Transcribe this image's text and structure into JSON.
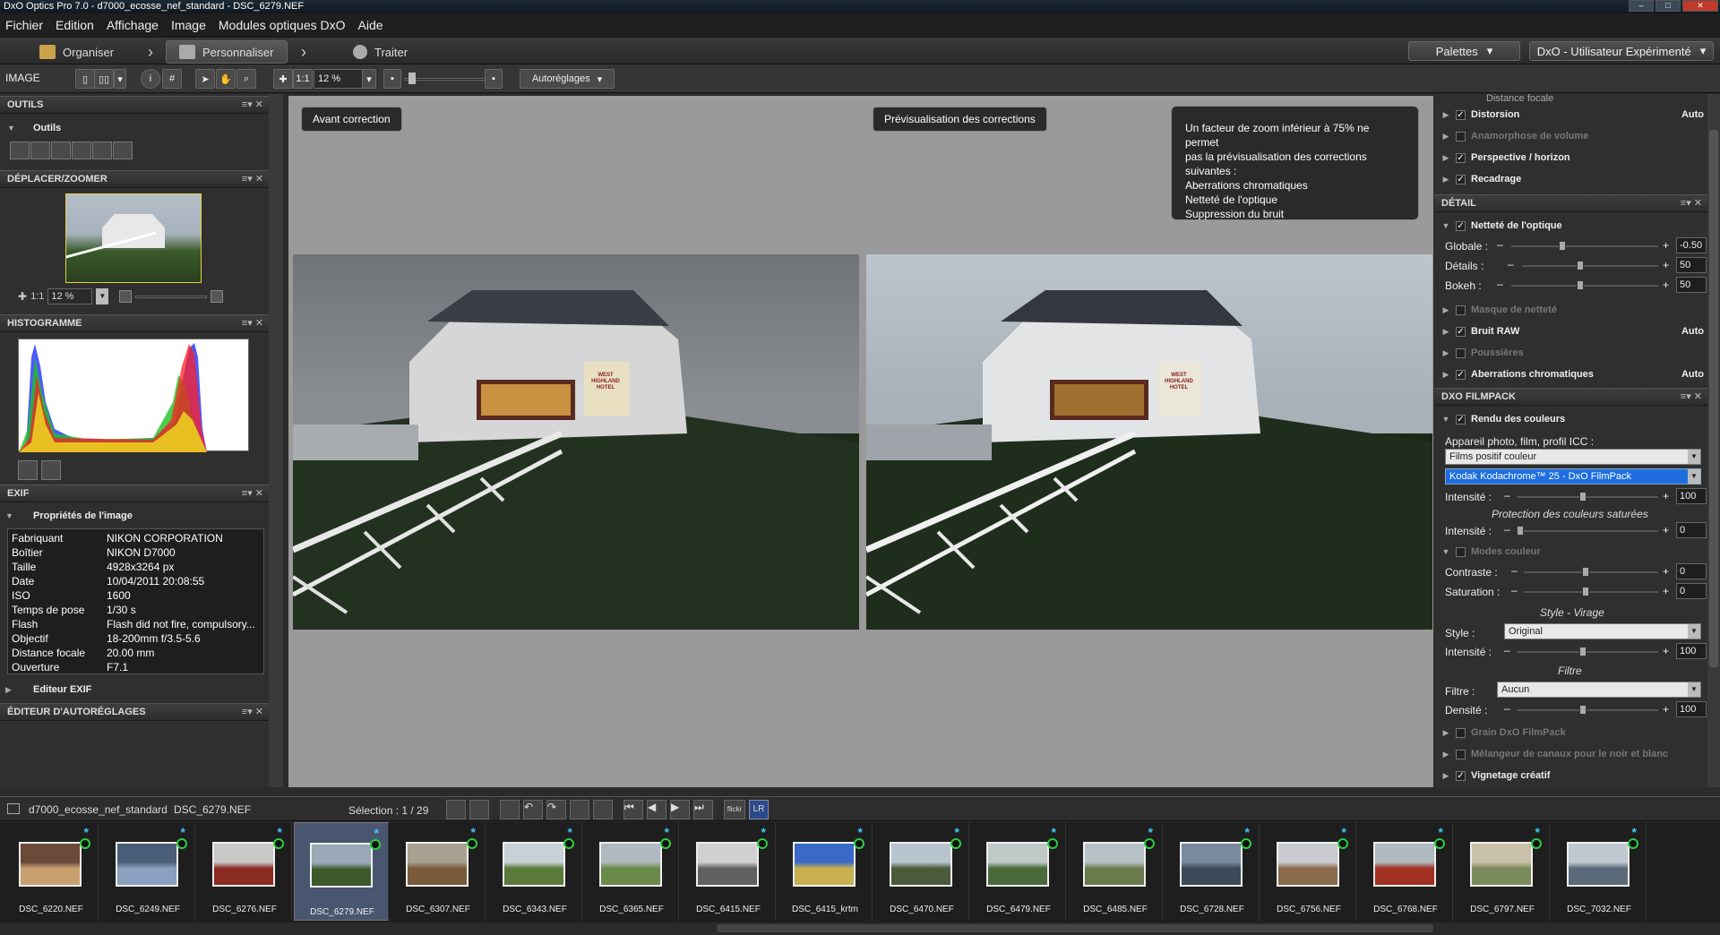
{
  "window": {
    "title": "DxO Optics Pro 7.0 - d7000_ecosse_nef_standard - DSC_6279.NEF"
  },
  "menu": [
    "Fichier",
    "Edition",
    "Affichage",
    "Image",
    "Modules optiques DxO",
    "Aide"
  ],
  "modules": {
    "organise": "Organiser",
    "customize": "Personnaliser",
    "process": "Traiter"
  },
  "topright": {
    "palettes": "Palettes",
    "workspace": "DxO - Utilisateur Expérimenté"
  },
  "toolbar": {
    "label": "IMAGE",
    "one_to_one": "1:1",
    "zoom": "12 %",
    "autopreset": "Autoréglages"
  },
  "left": {
    "tools_header": "OUTILS",
    "tools_sub": "Outils",
    "move_header": "DÉPLACER/ZOOMER",
    "move_zoom": "12 %",
    "move_one": "1:1",
    "histo_header": "HISTOGRAMME",
    "exif_header": "EXIF",
    "exif_sub": "Propriétés de l'image",
    "exif_rows": [
      {
        "k": "Fabriquant",
        "v": "NIKON CORPORATION"
      },
      {
        "k": "Boîtier",
        "v": "NIKON D7000"
      },
      {
        "k": "Taille",
        "v": "4928x3264 px"
      },
      {
        "k": "Date",
        "v": "10/04/2011 20:08:55"
      },
      {
        "k": "ISO",
        "v": "1600"
      },
      {
        "k": "Temps de pose",
        "v": "1/30 s"
      },
      {
        "k": "Flash",
        "v": "Flash did not fire, compulsory..."
      },
      {
        "k": "Objectif",
        "v": "18-200mm f/3.5-5.6"
      },
      {
        "k": "Distance focale",
        "v": "20.00 mm"
      },
      {
        "k": "Ouverture",
        "v": "F7.1"
      }
    ],
    "exif_editor": "Editeur EXIF",
    "preset_header": "ÉDITEUR D'AUTORÉGLAGES"
  },
  "center": {
    "before": "Avant correction",
    "preview": "Prévisualisation des corrections",
    "info_lines": [
      "Un facteur de zoom inférieur à 75% ne permet",
      "pas la prévisualisation des corrections",
      "suivantes :",
      "Aberrations chromatiques",
      "Netteté de l'optique",
      "Suppression du bruit"
    ],
    "sign_lines": [
      "WEST",
      "HIGHLAND",
      "HOTEL"
    ]
  },
  "right": {
    "partial": "Distance focale",
    "geo_items": [
      {
        "label": "Distorsion",
        "checked": true,
        "auto": "Auto"
      },
      {
        "label": "Anamorphose de volume",
        "checked": false,
        "auto": ""
      },
      {
        "label": "Perspective / horizon",
        "checked": true,
        "auto": ""
      },
      {
        "label": "Recadrage",
        "checked": true,
        "auto": ""
      }
    ],
    "detail_header": "DÉTAIL",
    "sharp_label": "Netteté de l'optique",
    "sliders_detail": [
      {
        "label": "Globale :",
        "value": "-0.50",
        "pos": 0.4
      },
      {
        "label": "Détails :",
        "value": "50",
        "pos": 0.5
      },
      {
        "label": "Bokeh :",
        "value": "50",
        "pos": 0.5
      }
    ],
    "detail_items": [
      {
        "label": "Masque de netteté",
        "checked": false,
        "auto": ""
      },
      {
        "label": "Bruit RAW",
        "checked": true,
        "auto": "Auto"
      },
      {
        "label": "Poussières",
        "checked": false,
        "auto": ""
      },
      {
        "label": "Aberrations chromatiques",
        "checked": true,
        "auto": "Auto"
      }
    ],
    "filmpack_header": "DXO FILMPACK",
    "color_render": "Rendu des couleurs",
    "profile_label": "Appareil photo, film, profil ICC :",
    "profile_cat": "Films positif couleur",
    "profile_film": "Kodak Kodachrome™ 25 - DxO FilmPack",
    "intensity": "Intensité :",
    "intensity_val": "100",
    "protect_label": "Protection des couleurs saturées",
    "protect_val": "0",
    "color_modes": "Modes couleur",
    "contrast": "Contraste :",
    "contrast_val": "0",
    "saturation": "Saturation :",
    "saturation_val": "0",
    "style_title": "Style - Virage",
    "style_label": "Style :",
    "style_val": "Original",
    "style_int_val": "100",
    "filter_title": "Filtre",
    "filter_label": "Filtre :",
    "filter_val": "Aucun",
    "density": "Densité :",
    "density_val": "100",
    "bottom_items": [
      {
        "label": "Grain DxO FilmPack",
        "checked": false
      },
      {
        "label": "Mélangeur de canaux pour le noir et blanc",
        "checked": false
      },
      {
        "label": "Vignetage créatif",
        "checked": true
      }
    ]
  },
  "filmbar": {
    "folder": "d7000_ecosse_nef_standard",
    "file": "DSC_6279.NEF",
    "selection": "Sélection : 1 / 29",
    "flickr": "flickr",
    "lr": "LR"
  },
  "thumbs": [
    {
      "name": "DSC_6220.NEF",
      "c1": "#6b4a3a",
      "c2": "#c8a070"
    },
    {
      "name": "DSC_6249.NEF",
      "c1": "#4a5e7a",
      "c2": "#8aa0c0"
    },
    {
      "name": "DSC_6276.NEF",
      "c1": "#c8c8c8",
      "c2": "#8a2a20"
    },
    {
      "name": "DSC_6279.NEF",
      "c1": "#9aa8b8",
      "c2": "#3a5a2a"
    },
    {
      "name": "DSC_6307.NEF",
      "c1": "#a8a090",
      "c2": "#7a5a3a"
    },
    {
      "name": "DSC_6343.NEF",
      "c1": "#c8d0d8",
      "c2": "#5a7a3a"
    },
    {
      "name": "DSC_6365.NEF",
      "c1": "#b0b8c0",
      "c2": "#6a8a4a"
    },
    {
      "name": "DSC_6415.NEF",
      "c1": "#d0d0d0",
      "c2": "#606060"
    },
    {
      "name": "DSC_6415_krtm",
      "c1": "#3a6ac8",
      "c2": "#c8b050"
    },
    {
      "name": "DSC_6470.NEF",
      "c1": "#b8c4d0",
      "c2": "#4a5a3a"
    },
    {
      "name": "DSC_6479.NEF",
      "c1": "#c0c8c8",
      "c2": "#4a6a3a"
    },
    {
      "name": "DSC_6485.NEF",
      "c1": "#b8c0c8",
      "c2": "#6a7a4a"
    },
    {
      "name": "DSC_6728.NEF",
      "c1": "#7a8aa0",
      "c2": "#3a4a5a"
    },
    {
      "name": "DSC_6756.NEF",
      "c1": "#c8ccd0",
      "c2": "#8a6a4a"
    },
    {
      "name": "DSC_6768.NEF",
      "c1": "#b0b8c0",
      "c2": "#a03020"
    },
    {
      "name": "DSC_6797.NEF",
      "c1": "#c8c0a8",
      "c2": "#7a8a5a"
    },
    {
      "name": "DSC_7032.NEF",
      "c1": "#c0c8d0",
      "c2": "#5a6a7a"
    }
  ]
}
